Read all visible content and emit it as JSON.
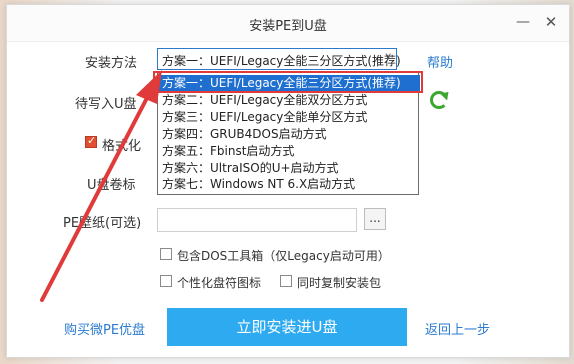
{
  "window": {
    "title": "安装PE到U盘",
    "minimize_symbol": "—",
    "close_symbol": "✕"
  },
  "form": {
    "install_method_label": "安装方法",
    "install_method_value": "方案一：UEFI/Legacy全能三分区方式(推荐)",
    "dropdown_arrow_symbol": "v",
    "help_label": "帮助",
    "target_disk_label": "待写入U盘",
    "format_label": "格式化",
    "format_checked": true,
    "usb_label_label": "U盘卷标",
    "wallpaper_label": "PE壁纸(可选)",
    "wallpaper_value": "",
    "browse_label": "...",
    "include_dos_label": "包含DOS工具箱（仅Legacy启动可用）",
    "custom_icon_label": "个性化盘符图标",
    "copy_installer_label": "同时复制安装包"
  },
  "dropdown": {
    "options": [
      "方案一：UEFI/Legacy全能三分区方式(推荐)",
      "方案二：UEFI/Legacy全能双分区方式",
      "方案三：UEFI/Legacy全能单分区方式",
      "方案四：GRUB4DOS启动方式",
      "方案五：Fbinst启动方式",
      "方案六：UltraISO的U+启动方式",
      "方案七：Windows NT 6.X启动方式"
    ],
    "selected_index": 0
  },
  "footer": {
    "buy_label": "购买微PE优盘",
    "install_label": "立即安装进U盘",
    "back_label": "返回上一步"
  },
  "colors": {
    "accent": "#2eaaf0",
    "link": "#2b7bd0",
    "highlight": "#e03a3a",
    "selection": "#1e6fcf",
    "refresh": "#3aa82e"
  },
  "icons": {
    "refresh": "refresh-icon",
    "annotation_arrow": "red-arrow-icon"
  }
}
